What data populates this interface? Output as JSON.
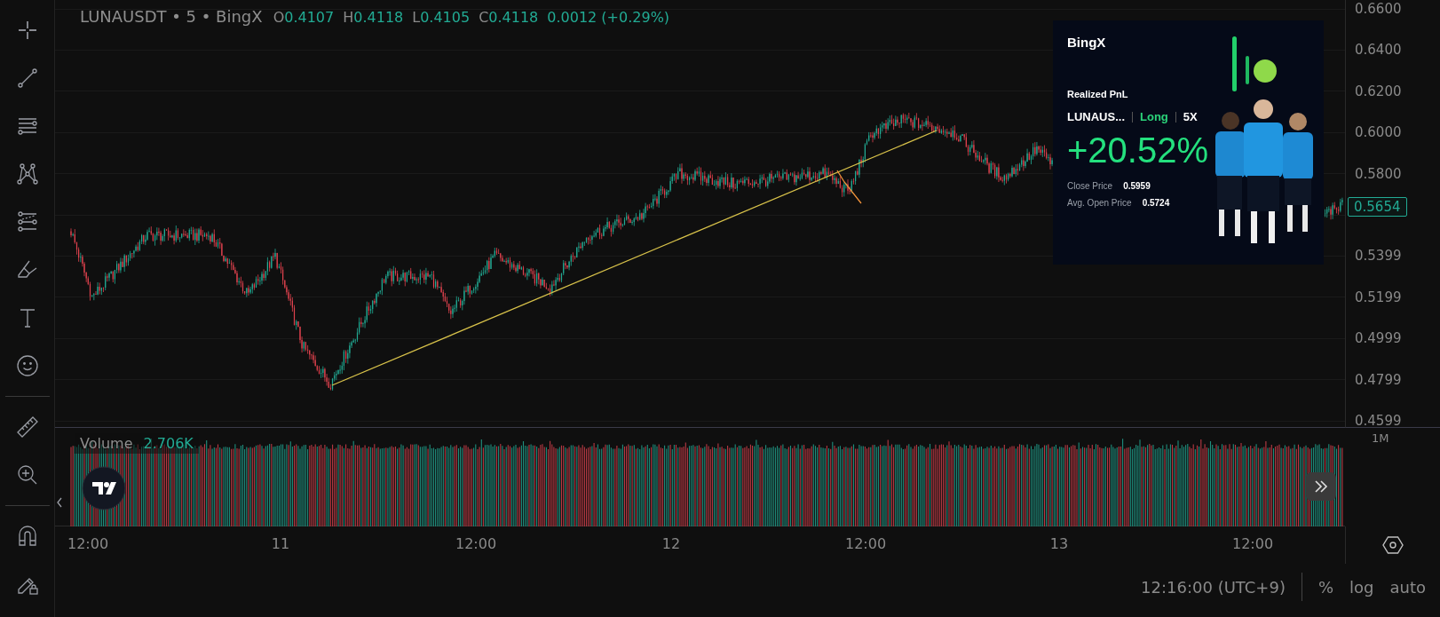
{
  "header": {
    "symbol": "LUNAUSDT • 5 • BingX",
    "ohlc": [
      {
        "label": "O",
        "value": "0.4107"
      },
      {
        "label": "H",
        "value": "0.4118"
      },
      {
        "label": "L",
        "value": "0.4105"
      },
      {
        "label": "C",
        "value": "0.4118"
      }
    ],
    "change": "0.0012 (+0.29%)"
  },
  "price_axis": {
    "ticks": [
      "0.6600",
      "0.6400",
      "0.6200",
      "0.6000",
      "0.5800",
      "0.5399",
      "0.5199",
      "0.4999",
      "0.4799",
      "0.4599"
    ],
    "current_price": "0.5654"
  },
  "volume": {
    "label": "Volume",
    "value": "2.706K",
    "scale": "1M"
  },
  "time_axis": [
    "12:00",
    "11",
    "12:00",
    "12",
    "12:00",
    "13",
    "12:00"
  ],
  "promo_card": {
    "logo": "BingX",
    "title": "Realized PnL",
    "pair": "LUNAUS...",
    "side": "Long",
    "leverage": "5X",
    "pnl": "+20.52%",
    "rows": [
      {
        "label": "Close Price",
        "value": "0.5959"
      },
      {
        "label": "Avg. Open Price",
        "value": "0.5724"
      }
    ]
  },
  "status_bar": {
    "time": "12:16:00 (UTC+9)",
    "options": [
      "%",
      "log",
      "auto"
    ]
  }
}
